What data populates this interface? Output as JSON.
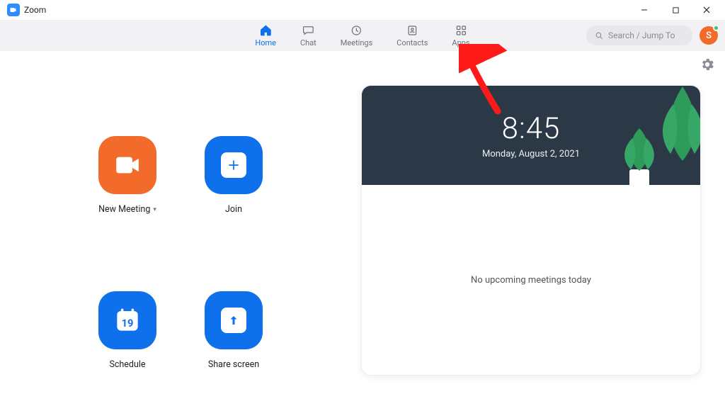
{
  "window": {
    "title": "Zoom"
  },
  "nav": {
    "home": "Home",
    "chat": "Chat",
    "meetings": "Meetings",
    "contacts": "Contacts",
    "apps": "Apps"
  },
  "search": {
    "placeholder": "Search / Jump To"
  },
  "avatar": {
    "initial": "S"
  },
  "actions": {
    "new_meeting": "New Meeting",
    "join": "Join",
    "schedule": "Schedule",
    "share_screen": "Share screen",
    "calendar_day": "19"
  },
  "clock": {
    "time": "8:45",
    "date": "Monday, August 2, 2021"
  },
  "status": {
    "no_meetings": "No upcoming meetings today"
  }
}
